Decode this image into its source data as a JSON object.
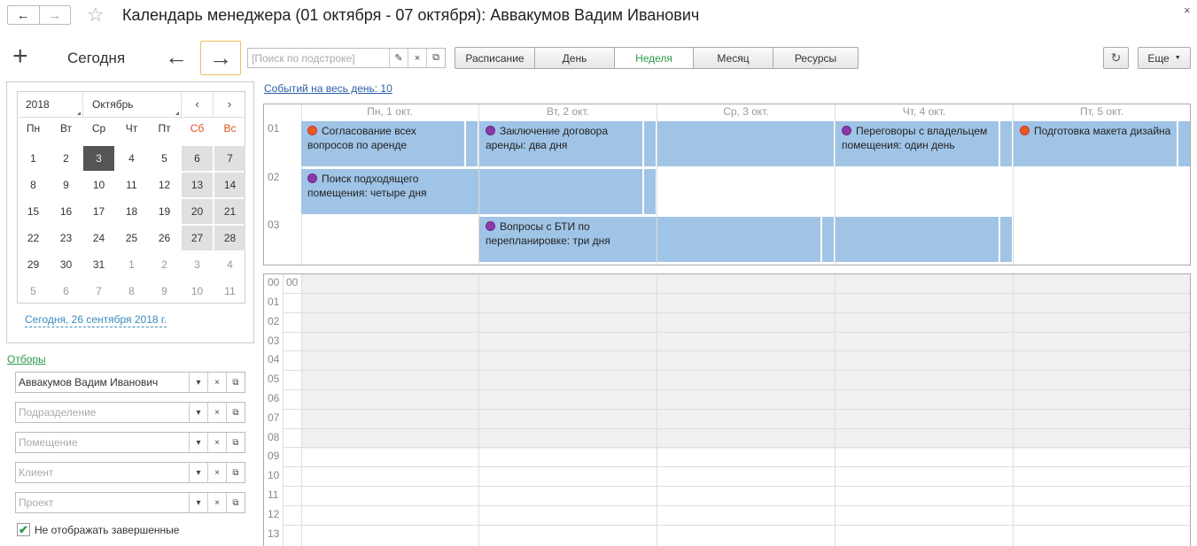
{
  "window": {
    "title": "Календарь менеджера (01 октября - 07 октября): Аввакумов Вадим Иванович",
    "back_icon": "←",
    "forward_icon": "→",
    "star_icon": "☆",
    "close_icon": "×"
  },
  "toolbar": {
    "add_icon": "+",
    "today_label": "Сегодня",
    "prev_icon": "←",
    "next_icon": "→",
    "search_placeholder": "[Поиск по подстроке]",
    "search_value": "",
    "search_edit_icon": "✎",
    "search_clear_icon": "×",
    "search_open_icon": "⧉",
    "views": [
      "Расписание",
      "День",
      "Неделя",
      "Месяц",
      "Ресурсы"
    ],
    "active_view": "Неделя",
    "refresh_icon": "↻",
    "more_label": "Еще",
    "more_caret": "▼"
  },
  "mini_calendar": {
    "year": "2018",
    "month": "Октябрь",
    "prev_icon": "‹",
    "next_icon": "›",
    "weekdays": [
      "Пн",
      "Вт",
      "Ср",
      "Чт",
      "Пт",
      "Сб",
      "Вс"
    ],
    "weeks": [
      [
        "1",
        "2",
        "3",
        "4",
        "5",
        "6",
        "7"
      ],
      [
        "8",
        "9",
        "10",
        "11",
        "12",
        "13",
        "14"
      ],
      [
        "15",
        "16",
        "17",
        "18",
        "19",
        "20",
        "21"
      ],
      [
        "22",
        "23",
        "24",
        "25",
        "26",
        "27",
        "28"
      ],
      [
        "29",
        "30",
        "31",
        "1",
        "2",
        "3",
        "4"
      ],
      [
        "5",
        "6",
        "7",
        "8",
        "9",
        "10",
        "11"
      ]
    ],
    "selected": "3",
    "today_link": "Сегодня, 26 сентября 2018 г."
  },
  "filters": {
    "link": "Отборы",
    "fields": [
      {
        "value": "Аввакумов Вадим Иванович",
        "placeholder": ""
      },
      {
        "value": "",
        "placeholder": "Подразделение"
      },
      {
        "value": "",
        "placeholder": "Помещение"
      },
      {
        "value": "",
        "placeholder": "Клиент"
      },
      {
        "value": "",
        "placeholder": "Проект"
      }
    ],
    "dropdown_icon": "▾",
    "clear_icon": "×",
    "open_icon": "⧉",
    "hide_completed": {
      "checked": true,
      "label": "Не отображать завершенные",
      "check_icon": "✔"
    }
  },
  "week": {
    "allday_link": "Событий на весь день: 10",
    "day_headers": [
      "Пн, 1 окт.",
      "Вт, 2 окт.",
      "Ср, 3 окт.",
      "Чт, 4 окт.",
      "Пт, 5 окт."
    ],
    "row_labels": [
      "01",
      "02",
      "03"
    ],
    "events": [
      {
        "text": "Согласование всех вопросов по аренде",
        "color": "orange"
      },
      {
        "text": "Заключение договора аренды: два дня",
        "color": "purple"
      },
      {
        "text": "Переговоры с владельцем помещения: один день",
        "color": "purple"
      },
      {
        "text": "Подготовка макета дизайна",
        "color": "orange"
      },
      {
        "text": "Поиск подходящего помещения: четыре дня",
        "color": "purple"
      },
      {
        "text": "Вопросы с БТИ по перепланировке: три дня",
        "color": "purple"
      }
    ]
  },
  "time_grid": {
    "corner_labels": [
      "00",
      "00"
    ],
    "hours": [
      "01",
      "02",
      "03",
      "04",
      "05",
      "06",
      "07",
      "08",
      "09",
      "10",
      "11",
      "12",
      "13"
    ]
  },
  "colors": {
    "event_bg": "#a0c4e6",
    "active_view": "#2a9a4a",
    "weekend": "#d9531e",
    "link": "#2a5ea8",
    "orange_dot": "#ea5a1e",
    "purple_dot": "#8a3aa8"
  }
}
